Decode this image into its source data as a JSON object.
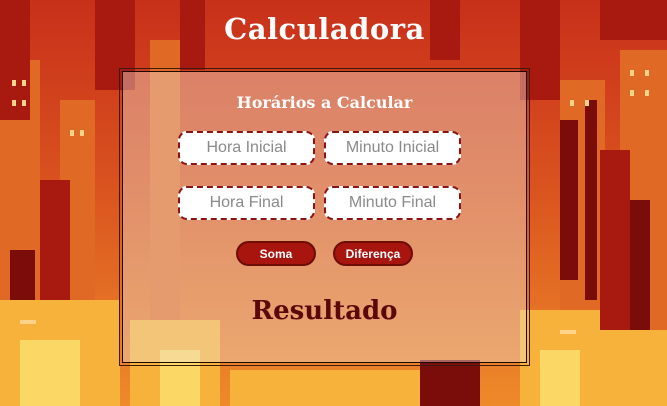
{
  "page": {
    "title": "Calculadora"
  },
  "panel": {
    "heading": "Horários a Calcular",
    "inputs": {
      "hora_inicial": {
        "placeholder": "Hora Inicial",
        "value": ""
      },
      "minuto_inicial": {
        "placeholder": "Minuto Inicial",
        "value": ""
      },
      "hora_final": {
        "placeholder": "Hora Final",
        "value": ""
      },
      "minuto_final": {
        "placeholder": "Minuto Final",
        "value": ""
      }
    },
    "buttons": {
      "soma": "Soma",
      "diferenca": "Diferença"
    },
    "result": "Resultado"
  },
  "colors": {
    "accent": "#a8140e",
    "result_text": "#5a0808",
    "field_border": "#8a1414"
  }
}
